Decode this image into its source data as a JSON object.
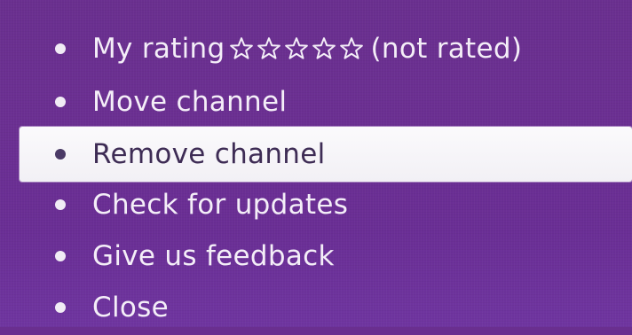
{
  "menu": {
    "rating": {
      "label": "My rating",
      "stars": 0,
      "max_stars": 5,
      "status": "(not rated)",
      "star_icon": "star-outline-icon"
    },
    "items": [
      {
        "label": "Move channel"
      },
      {
        "label": "Remove channel",
        "selected": true
      },
      {
        "label": "Check for updates"
      },
      {
        "label": "Give us feedback"
      },
      {
        "label": "Close"
      }
    ]
  },
  "colors": {
    "background": "#6b2f92",
    "text": "#f4eef8",
    "highlight": "#f7f6f9",
    "highlight_text": "#3e2c55"
  }
}
